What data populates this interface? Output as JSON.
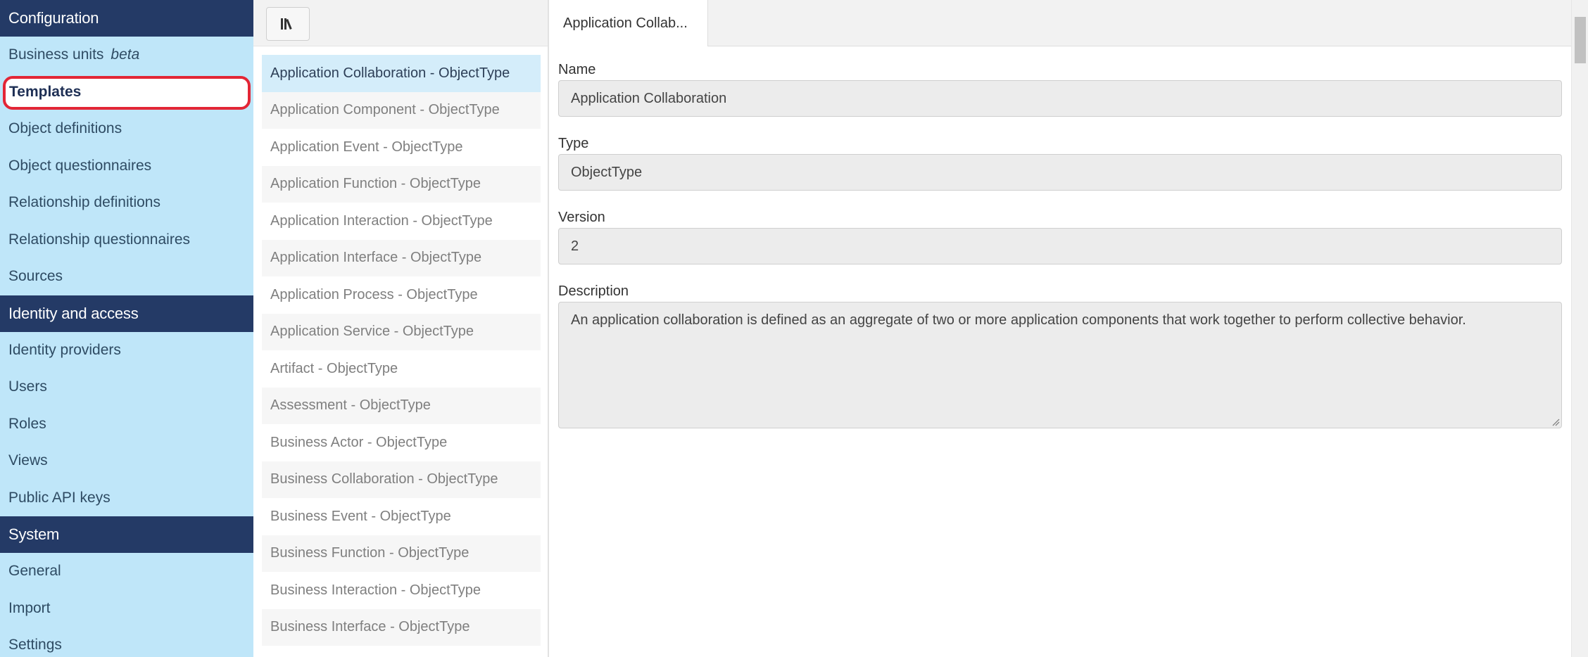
{
  "nav": {
    "sections": [
      {
        "title": "Configuration",
        "items": [
          {
            "label": "Business units",
            "badge": "beta"
          },
          {
            "label": "Templates",
            "active": true
          },
          {
            "label": "Object definitions"
          },
          {
            "label": "Object questionnaires"
          },
          {
            "label": "Relationship definitions"
          },
          {
            "label": "Relationship questionnaires"
          },
          {
            "label": "Sources"
          }
        ]
      },
      {
        "title": "Identity and access",
        "items": [
          {
            "label": "Identity providers"
          },
          {
            "label": "Users"
          },
          {
            "label": "Roles"
          },
          {
            "label": "Views"
          },
          {
            "label": "Public API keys"
          }
        ]
      },
      {
        "title": "System",
        "items": [
          {
            "label": "General"
          },
          {
            "label": "Import"
          },
          {
            "label": "Settings"
          }
        ]
      }
    ]
  },
  "list": {
    "toolbar_icon": "library-icon",
    "items": [
      "Application Collaboration - ObjectType",
      "Application Component - ObjectType",
      "Application Event - ObjectType",
      "Application Function - ObjectType",
      "Application Interaction - ObjectType",
      "Application Interface - ObjectType",
      "Application Process - ObjectType",
      "Application Service - ObjectType",
      "Artifact - ObjectType",
      "Assessment - ObjectType",
      "Business Actor - ObjectType",
      "Business Collaboration - ObjectType",
      "Business Event - ObjectType",
      "Business Function - ObjectType",
      "Business Interaction - ObjectType",
      "Business Interface - ObjectType"
    ],
    "selected_index": 0
  },
  "detail": {
    "tab_label": "Application Collab...",
    "fields": {
      "name_label": "Name",
      "name_value": "Application Collaboration",
      "type_label": "Type",
      "type_value": "ObjectType",
      "version_label": "Version",
      "version_value": "2",
      "description_label": "Description",
      "description_value": "An application collaboration is defined as an aggregate of two or more application components that work together to perform collective behavior."
    }
  },
  "colors": {
    "nav_background": "#bfe6f9",
    "nav_header": "#243a66",
    "active_highlight": "#e32636",
    "selected_item": "#d4edfa"
  }
}
